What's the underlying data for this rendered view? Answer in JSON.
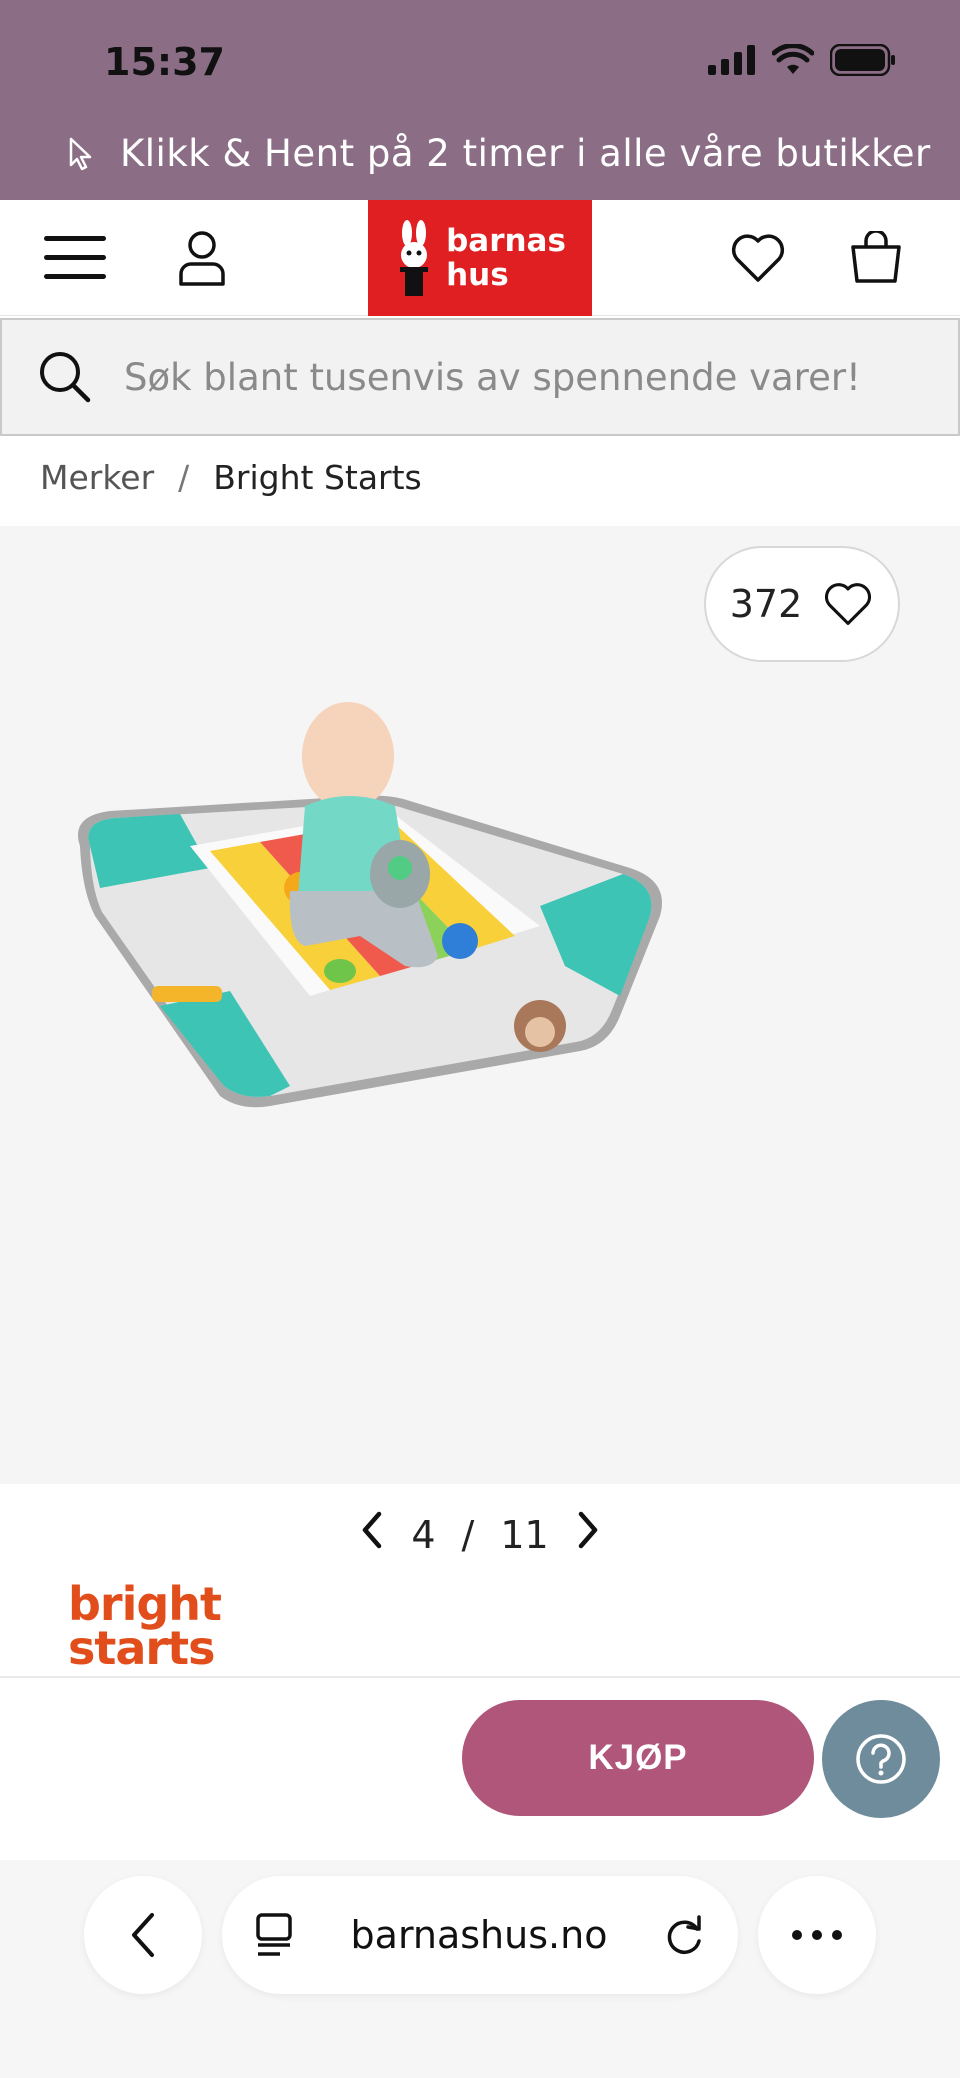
{
  "status": {
    "time": "15:37"
  },
  "promo": {
    "text": "Klikk & Hent på 2 timer i alle våre butikker"
  },
  "header": {
    "logo_line1": "barnas",
    "logo_line2": "hus",
    "logo_color": "#e01f22"
  },
  "search": {
    "placeholder": "Søk blant tusenvis av spennende varer!"
  },
  "breadcrumb": {
    "parent": "Merker",
    "separator": "/",
    "current": "Bright Starts"
  },
  "gallery": {
    "favorites_count": "372",
    "current_index": "4",
    "separator": "/",
    "total": "11"
  },
  "brand": {
    "line1": "bright",
    "line2": "starts",
    "color": "#e24e1b"
  },
  "actions": {
    "buy_label": "KJØP",
    "buy_color": "#b0567a",
    "help_color": "#6f8c9c"
  },
  "browser": {
    "url": "barnashus.no"
  },
  "icons": {
    "menu": "hamburger-icon",
    "account": "user-icon",
    "wishlist": "heart-icon",
    "cart": "bag-icon",
    "search": "search-icon",
    "favorite": "heart-icon",
    "prev": "chevron-left-icon",
    "next": "chevron-right-icon",
    "help": "question-icon",
    "back": "chevron-left-icon",
    "reader": "reader-icon",
    "reload": "reload-icon",
    "more": "more-icon"
  }
}
